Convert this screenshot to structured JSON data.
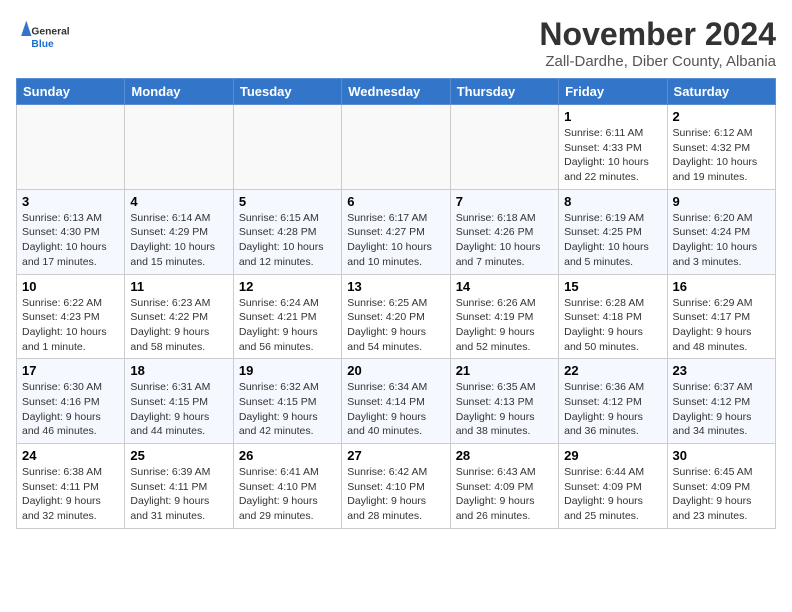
{
  "header": {
    "logo_general": "General",
    "logo_blue": "Blue",
    "month_title": "November 2024",
    "location": "Zall-Dardhe, Diber County, Albania"
  },
  "weekdays": [
    "Sunday",
    "Monday",
    "Tuesday",
    "Wednesday",
    "Thursday",
    "Friday",
    "Saturday"
  ],
  "weeks": [
    [
      {
        "day": "",
        "info": ""
      },
      {
        "day": "",
        "info": ""
      },
      {
        "day": "",
        "info": ""
      },
      {
        "day": "",
        "info": ""
      },
      {
        "day": "",
        "info": ""
      },
      {
        "day": "1",
        "info": "Sunrise: 6:11 AM\nSunset: 4:33 PM\nDaylight: 10 hours and 22 minutes."
      },
      {
        "day": "2",
        "info": "Sunrise: 6:12 AM\nSunset: 4:32 PM\nDaylight: 10 hours and 19 minutes."
      }
    ],
    [
      {
        "day": "3",
        "info": "Sunrise: 6:13 AM\nSunset: 4:30 PM\nDaylight: 10 hours and 17 minutes."
      },
      {
        "day": "4",
        "info": "Sunrise: 6:14 AM\nSunset: 4:29 PM\nDaylight: 10 hours and 15 minutes."
      },
      {
        "day": "5",
        "info": "Sunrise: 6:15 AM\nSunset: 4:28 PM\nDaylight: 10 hours and 12 minutes."
      },
      {
        "day": "6",
        "info": "Sunrise: 6:17 AM\nSunset: 4:27 PM\nDaylight: 10 hours and 10 minutes."
      },
      {
        "day": "7",
        "info": "Sunrise: 6:18 AM\nSunset: 4:26 PM\nDaylight: 10 hours and 7 minutes."
      },
      {
        "day": "8",
        "info": "Sunrise: 6:19 AM\nSunset: 4:25 PM\nDaylight: 10 hours and 5 minutes."
      },
      {
        "day": "9",
        "info": "Sunrise: 6:20 AM\nSunset: 4:24 PM\nDaylight: 10 hours and 3 minutes."
      }
    ],
    [
      {
        "day": "10",
        "info": "Sunrise: 6:22 AM\nSunset: 4:23 PM\nDaylight: 10 hours and 1 minute."
      },
      {
        "day": "11",
        "info": "Sunrise: 6:23 AM\nSunset: 4:22 PM\nDaylight: 9 hours and 58 minutes."
      },
      {
        "day": "12",
        "info": "Sunrise: 6:24 AM\nSunset: 4:21 PM\nDaylight: 9 hours and 56 minutes."
      },
      {
        "day": "13",
        "info": "Sunrise: 6:25 AM\nSunset: 4:20 PM\nDaylight: 9 hours and 54 minutes."
      },
      {
        "day": "14",
        "info": "Sunrise: 6:26 AM\nSunset: 4:19 PM\nDaylight: 9 hours and 52 minutes."
      },
      {
        "day": "15",
        "info": "Sunrise: 6:28 AM\nSunset: 4:18 PM\nDaylight: 9 hours and 50 minutes."
      },
      {
        "day": "16",
        "info": "Sunrise: 6:29 AM\nSunset: 4:17 PM\nDaylight: 9 hours and 48 minutes."
      }
    ],
    [
      {
        "day": "17",
        "info": "Sunrise: 6:30 AM\nSunset: 4:16 PM\nDaylight: 9 hours and 46 minutes."
      },
      {
        "day": "18",
        "info": "Sunrise: 6:31 AM\nSunset: 4:15 PM\nDaylight: 9 hours and 44 minutes."
      },
      {
        "day": "19",
        "info": "Sunrise: 6:32 AM\nSunset: 4:15 PM\nDaylight: 9 hours and 42 minutes."
      },
      {
        "day": "20",
        "info": "Sunrise: 6:34 AM\nSunset: 4:14 PM\nDaylight: 9 hours and 40 minutes."
      },
      {
        "day": "21",
        "info": "Sunrise: 6:35 AM\nSunset: 4:13 PM\nDaylight: 9 hours and 38 minutes."
      },
      {
        "day": "22",
        "info": "Sunrise: 6:36 AM\nSunset: 4:12 PM\nDaylight: 9 hours and 36 minutes."
      },
      {
        "day": "23",
        "info": "Sunrise: 6:37 AM\nSunset: 4:12 PM\nDaylight: 9 hours and 34 minutes."
      }
    ],
    [
      {
        "day": "24",
        "info": "Sunrise: 6:38 AM\nSunset: 4:11 PM\nDaylight: 9 hours and 32 minutes."
      },
      {
        "day": "25",
        "info": "Sunrise: 6:39 AM\nSunset: 4:11 PM\nDaylight: 9 hours and 31 minutes."
      },
      {
        "day": "26",
        "info": "Sunrise: 6:41 AM\nSunset: 4:10 PM\nDaylight: 9 hours and 29 minutes."
      },
      {
        "day": "27",
        "info": "Sunrise: 6:42 AM\nSunset: 4:10 PM\nDaylight: 9 hours and 28 minutes."
      },
      {
        "day": "28",
        "info": "Sunrise: 6:43 AM\nSunset: 4:09 PM\nDaylight: 9 hours and 26 minutes."
      },
      {
        "day": "29",
        "info": "Sunrise: 6:44 AM\nSunset: 4:09 PM\nDaylight: 9 hours and 25 minutes."
      },
      {
        "day": "30",
        "info": "Sunrise: 6:45 AM\nSunset: 4:09 PM\nDaylight: 9 hours and 23 minutes."
      }
    ]
  ]
}
